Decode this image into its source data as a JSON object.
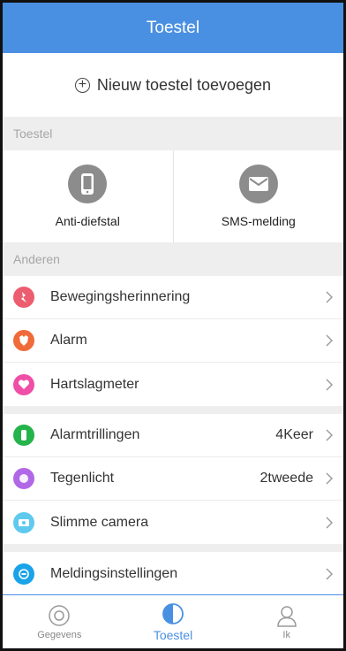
{
  "header": {
    "title": "Toestel"
  },
  "add_device": {
    "label": "Nieuw toestel toevoegen"
  },
  "section_device": {
    "label": "Toestel"
  },
  "tiles": [
    {
      "label": "Anti-diefstal",
      "icon": "phone-icon"
    },
    {
      "label": "SMS-melding",
      "icon": "envelope-icon"
    }
  ],
  "section_other": {
    "label": "Anderen"
  },
  "group1": [
    {
      "label": "Bewegingsherinnering",
      "icon": "movement-icon",
      "color": "#ec5d6f"
    },
    {
      "label": "Alarm",
      "icon": "alarm-icon",
      "color": "#ef6b3a"
    },
    {
      "label": "Hartslagmeter",
      "icon": "heart-icon",
      "color": "#ef4fa6"
    }
  ],
  "group2": [
    {
      "label": "Alarmtrillingen",
      "value": "4Keer",
      "icon": "vibration-icon",
      "color": "#25b34b"
    },
    {
      "label": "Tegenlicht",
      "value": "2tweede",
      "icon": "backlight-icon",
      "color": "#b168e6"
    },
    {
      "label": "Slimme camera",
      "icon": "camera-icon",
      "color": "#5fc9ee"
    }
  ],
  "group3": [
    {
      "label": "Meldingsinstellingen",
      "icon": "notification-icon",
      "color": "#1aa3e8"
    }
  ],
  "tabbar": {
    "tabs": [
      {
        "label": "Gegevens",
        "icon": "data-icon"
      },
      {
        "label": "Toestel",
        "icon": "device-icon"
      },
      {
        "label": "Ik",
        "icon": "person-icon"
      }
    ],
    "active": "Toestel"
  },
  "colors": {
    "accent": "#4a90e2",
    "tile_icon": "#8c8c8c"
  }
}
